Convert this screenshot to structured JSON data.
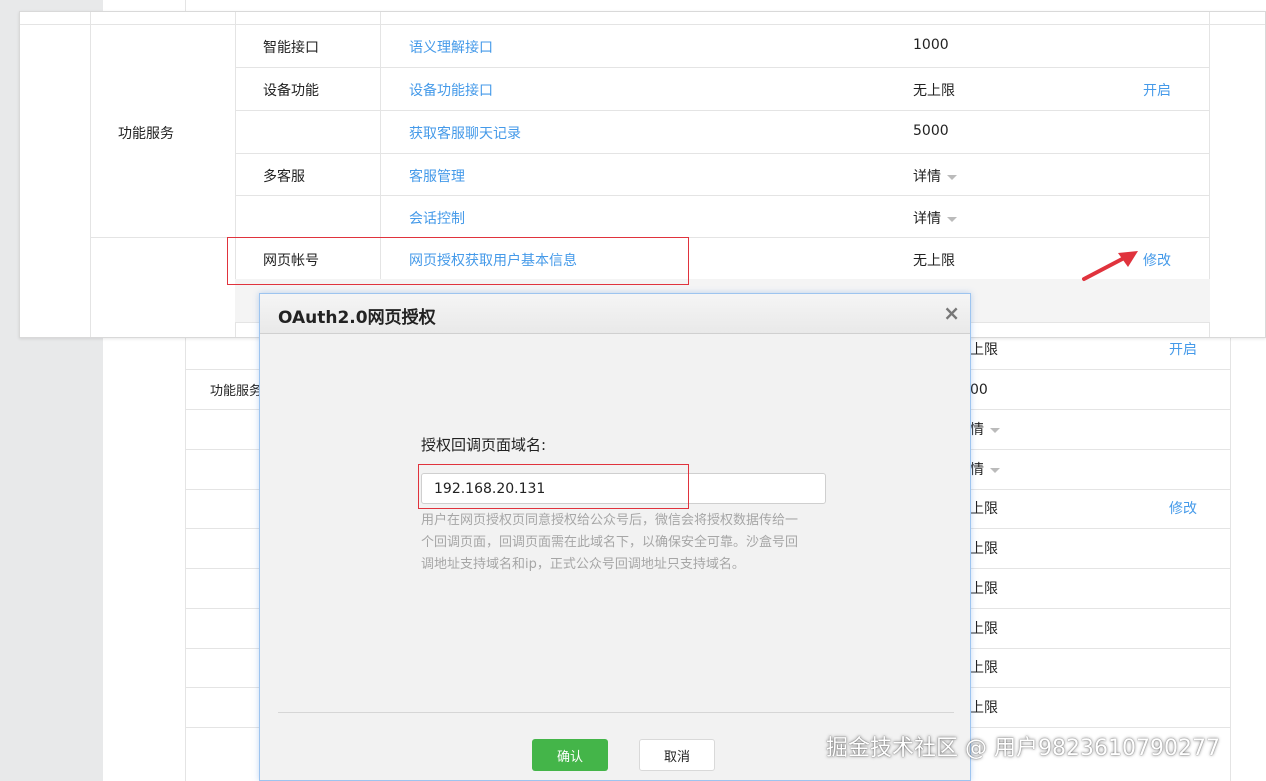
{
  "top_table": {
    "group_label": "功能服务",
    "rows": [
      {
        "name": "智能接口",
        "link": "语义理解接口",
        "value": "1000",
        "action": ""
      },
      {
        "name": "设备功能",
        "link": "设备功能接口",
        "value": "无上限",
        "action": "开启"
      },
      {
        "name": "",
        "link": "获取客服聊天记录",
        "value": "5000",
        "action": ""
      },
      {
        "name": "",
        "link": "客服管理",
        "value": "详情",
        "action": ""
      },
      {
        "name": "",
        "link": "会话控制",
        "value": "详情",
        "action": ""
      },
      {
        "name": "网页帐号",
        "link": "网页授权获取用户基本信息",
        "value": "无上限",
        "action": "修改"
      }
    ],
    "multi_service_label": "多客服"
  },
  "background_table": {
    "group_label": "功能服务",
    "rows": [
      {
        "value": "上限",
        "action": "开启"
      },
      {
        "value": "00",
        "action": ""
      },
      {
        "value": "情",
        "action": ""
      },
      {
        "value": "情",
        "action": ""
      },
      {
        "value": "上限",
        "action": "修改"
      },
      {
        "value": "上限",
        "action": ""
      },
      {
        "value": "上限",
        "action": ""
      },
      {
        "value": "上限",
        "action": ""
      },
      {
        "value": "上限",
        "action": ""
      },
      {
        "value": "上限",
        "action": ""
      }
    ]
  },
  "dialog": {
    "title": "OAuth2.0网页授权",
    "close_symbol": "×",
    "field_label": "授权回调页面域名:",
    "field_value": "192.168.20.131",
    "help_text": "用户在网页授权页同意授权给公众号后，微信会将授权数据传给一个回调页面，回调页面需在此域名下，以确保安全可靠。沙盒号回调地址支持域名和ip，正式公众号回调地址只支持域名。",
    "confirm_label": "确认",
    "cancel_label": "取消"
  },
  "watermark": "掘金技术社区 @ 用户9823610790277",
  "colors": {
    "link": "#459ae9",
    "confirm_green": "#44b549",
    "highlight_red": "#e0333d"
  }
}
